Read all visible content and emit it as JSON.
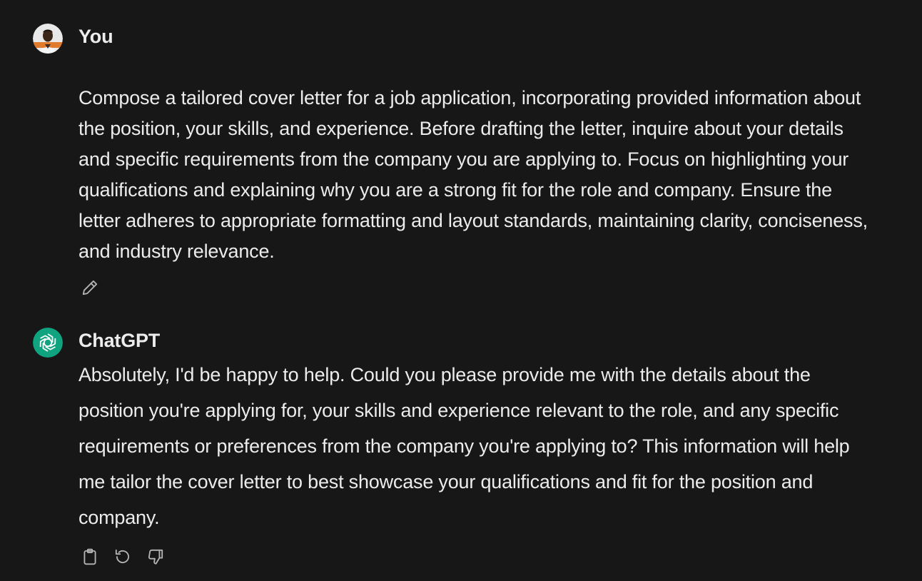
{
  "conversation": {
    "user_turn": {
      "author": "You",
      "message": "Compose a tailored cover letter for a job application, incorporating provided information about the position, your skills, and experience. Before drafting the letter, inquire about your details and specific requirements from the company you are applying to. Focus on highlighting your qualifications and explaining why you are a strong fit for the role and company. Ensure the letter adheres to appropriate formatting and layout standards, maintaining clarity, conciseness, and industry relevance.",
      "actions": {
        "edit_icon": "pencil-icon"
      }
    },
    "assistant_turn": {
      "author": "ChatGPT",
      "message": "Absolutely, I'd be happy to help. Could you please provide me with the details about the position you're applying for, your skills and experience relevant to the role, and any specific requirements or preferences from the company you're applying to? This information will help me tailor the cover letter to best showcase your qualifications and fit for the position and company.",
      "actions": {
        "copy_icon": "clipboard-icon",
        "regenerate_icon": "refresh-icon",
        "dislike_icon": "thumbs-down-icon"
      }
    }
  },
  "colors": {
    "background": "#171717",
    "text": "#ececec",
    "icon": "#b4b4b4",
    "chatgpt_brand": "#10a37f"
  }
}
